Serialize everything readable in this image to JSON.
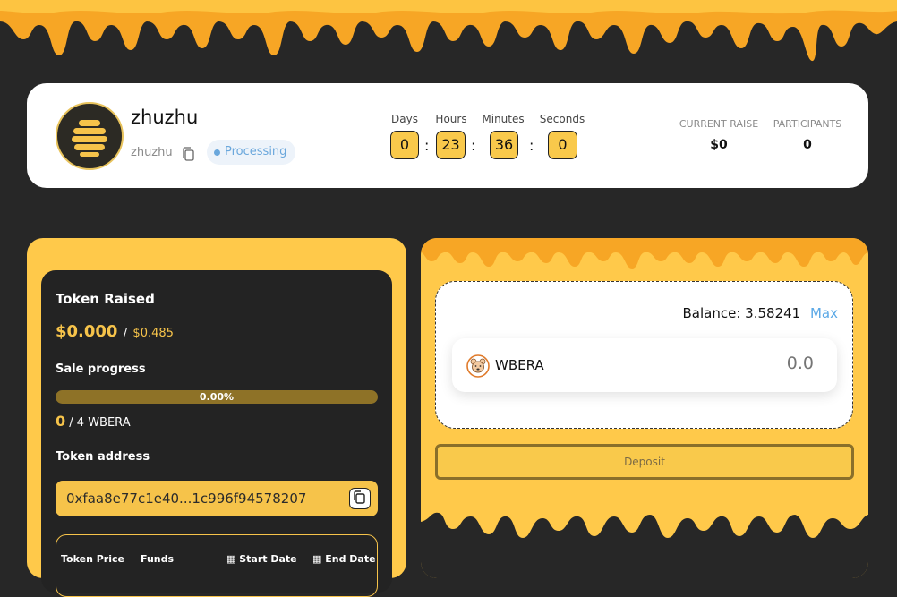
{
  "project": {
    "name": "zhuzhu",
    "handle": "zhuzhu",
    "status": "Processing"
  },
  "countdown": {
    "days_label": "Days",
    "days": "0",
    "hours_label": "Hours",
    "hours": "23",
    "minutes_label": "Minutes",
    "minutes": "36",
    "seconds_label": "Seconds",
    "seconds": "0",
    "separator": ":"
  },
  "stats": {
    "current_raise_label": "CURRENT RAISE",
    "current_raise": "$0",
    "participants_label": "PARTICIPANTS",
    "participants": "0"
  },
  "token_info": {
    "raised_label": "Token Raised",
    "raised": "$0.000",
    "raised_separator": "/",
    "raised_target": "$0.485",
    "sale_progress_label": "Sale progress",
    "progress_percent_text": "0.00%",
    "progress_fraction": 0,
    "progress_amount": "0",
    "progress_total": "/ 4 WBERA",
    "address_label": "Token address",
    "address": "0xfaa8e77c1e40...1c996f94578207",
    "table_headers": [
      "Token Price",
      "Funds",
      "Start Date",
      "End Date"
    ]
  },
  "deposit": {
    "balance_label": "Balance:",
    "balance_value": "3.58241",
    "max_label": "Max",
    "token": "WBERA",
    "amount_placeholder": "0.0",
    "button_label": "Deposit"
  },
  "colors": {
    "honey": "#ffc94a",
    "honey_dark": "#f6c34a",
    "background": "#272727",
    "accent_blue": "#5aa8e6"
  }
}
